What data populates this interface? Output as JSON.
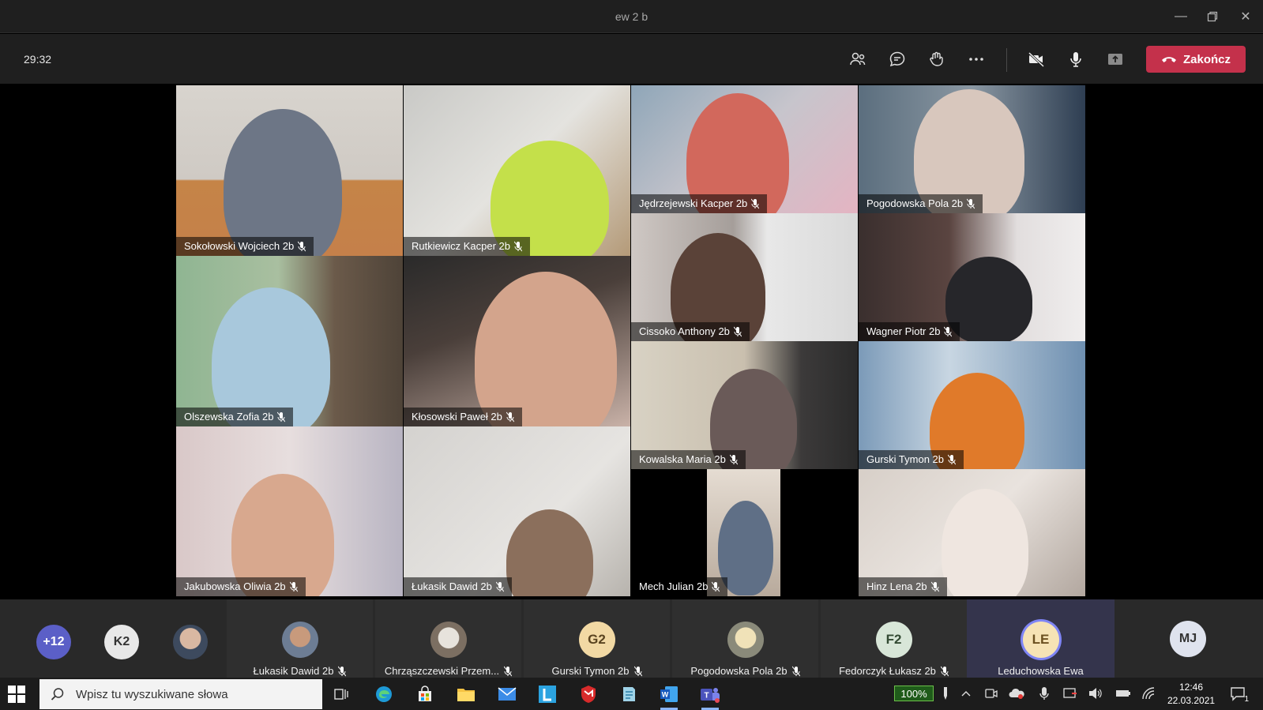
{
  "window": {
    "title": "ew 2 b"
  },
  "controls": {
    "timer": "29:32",
    "end_label": "Zakończ",
    "icons": [
      "people-icon",
      "chat-icon",
      "reactions-icon",
      "more-icon",
      "camera-off-icon",
      "microphone-icon",
      "share-tray-icon"
    ]
  },
  "tiles": [
    {
      "name": "Sokołowski Wojciech 2b",
      "muted": true
    },
    {
      "name": "Rutkiewicz Kacper 2b",
      "muted": true
    },
    {
      "name": "Jędrzejewski Kacper 2b",
      "muted": true
    },
    {
      "name": "Pogodowska Pola 2b",
      "muted": true
    },
    {
      "name": "Cissoko Anthony 2b",
      "muted": true
    },
    {
      "name": "Wagner Piotr 2b",
      "muted": true
    },
    {
      "name": "Olszewska Zofia 2b",
      "muted": true
    },
    {
      "name": "Kłosowski Paweł 2b",
      "muted": true
    },
    {
      "name": "Kowalska Maria 2b",
      "muted": true
    },
    {
      "name": "Gurski Tymon 2b",
      "muted": true
    },
    {
      "name": "Jakubowska Oliwia 2b",
      "muted": true
    },
    {
      "name": "Łukasik Dawid 2b",
      "muted": true
    },
    {
      "name": "Mech Julian 2b",
      "muted": true
    },
    {
      "name": "Hinz Lena 2b",
      "muted": true
    }
  ],
  "strip": {
    "overflow_count": "+12",
    "chips": [
      "K2"
    ],
    "participants": [
      {
        "name": "Łukasik Dawid 2b",
        "initials": "",
        "muted": true
      },
      {
        "name": "Chrząszczewski Przem...",
        "initials": "",
        "muted": true
      },
      {
        "name": "Gurski Tymon 2b",
        "initials": "G2",
        "muted": true
      },
      {
        "name": "Pogodowska Pola 2b",
        "initials": "",
        "muted": true
      },
      {
        "name": "Fedorczyk Łukasz 2b",
        "initials": "F2",
        "muted": true
      },
      {
        "name": "Leduchowska Ewa",
        "initials": "LE",
        "muted": false
      }
    ],
    "self_initials": "MJ"
  },
  "taskbar": {
    "search_placeholder": "Wpisz tu wyszukiwane słowa",
    "battery": "100%",
    "time": "12:46",
    "date": "22.03.2021",
    "notification_count": "1"
  }
}
